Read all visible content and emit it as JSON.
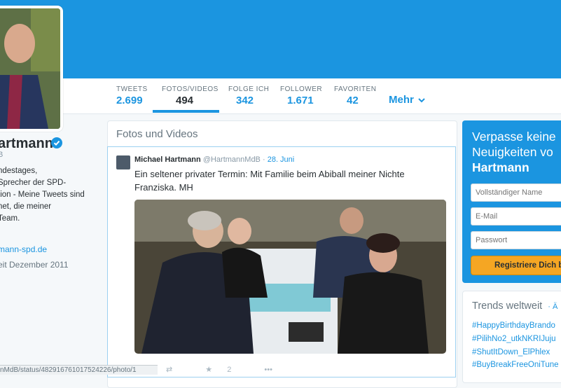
{
  "nav": {
    "items": [
      {
        "label": "TWEETS",
        "value": "2.699"
      },
      {
        "label": "FOTOS/VIDEOS",
        "value": "494"
      },
      {
        "label": "FOLGE ICH",
        "value": "342"
      },
      {
        "label": "FOLLOWER",
        "value": "1.671"
      },
      {
        "label": "FAVORITEN",
        "value": "42"
      }
    ],
    "more": "Mehr"
  },
  "profile": {
    "name_fragment": "artmann",
    "handle_fragment": "B",
    "bio": "ndestages,\n Sprecher der SPD-\ntion - Meine Tweets sind\nnet, die meiner\nTeam.",
    "link": "mann-spd.de",
    "joined": "eit Dezember 2011"
  },
  "main": {
    "title": "Fotos und Videos",
    "tweet": {
      "author": "Michael Hartmann",
      "handle": "@HartmannMdB",
      "date": "28. Juni",
      "text": "Ein seltener privater Termin: Mit Familie beim Abiball meiner Nichte Franziska. MH",
      "favorites": "2"
    }
  },
  "status_url": "nMdB/status/482916761017524226/photo/1",
  "signup": {
    "title_line1": "Verpasse keine",
    "title_line2": "Neuigkeiten vo",
    "title_name": "Hartmann",
    "name_placeholder": "Vollständiger Name",
    "email_placeholder": "E-Mail",
    "password_placeholder": "Passwort",
    "button_label": "Registriere Dich b"
  },
  "trends": {
    "title": "Trends weltweit",
    "change_label": "· Ä",
    "items": [
      "#HappyBirthdayBrando",
      "#PilihNo2_utkNKRIJuju",
      "#ShutItDown_ElPhlex",
      "#BuyBreakFreeOniTune"
    ]
  }
}
